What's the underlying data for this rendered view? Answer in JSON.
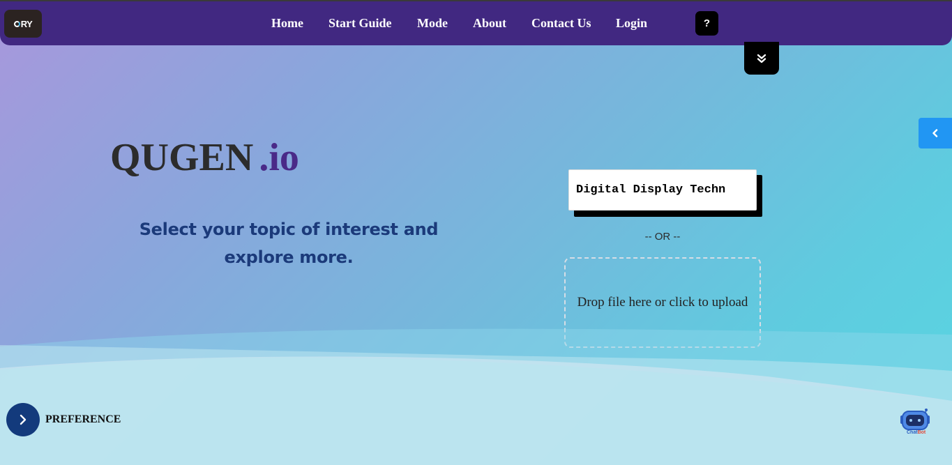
{
  "navbar": {
    "logo_text": "RY",
    "links": [
      "Home",
      "Start Guide",
      "Mode",
      "About",
      "Contact Us",
      "Login"
    ],
    "help_label": "?"
  },
  "hero": {
    "brand_main": "QUGEN",
    "brand_suffix": ".io",
    "tagline": "Select your topic of interest and explore more."
  },
  "search": {
    "topic_value": "Digital Display Techn",
    "or_text": "-- OR --",
    "dropzone_text": "Drop file here or click to upload"
  },
  "preference": {
    "label": "PREFERENCE"
  },
  "chatbot": {
    "label_a": "Chat",
    "label_b": "Bot"
  },
  "icons": {
    "collapse": "chevrons-down-icon",
    "side_tab": "chevron-left-icon",
    "preference": "chevron-right-icon",
    "chatbot": "robot-icon"
  },
  "colors": {
    "navbar": "#412881",
    "brand_suffix": "#4a2a88",
    "tagline": "#1b3a7a",
    "side_tab": "#2196f3",
    "preference_button": "#133a7c"
  }
}
